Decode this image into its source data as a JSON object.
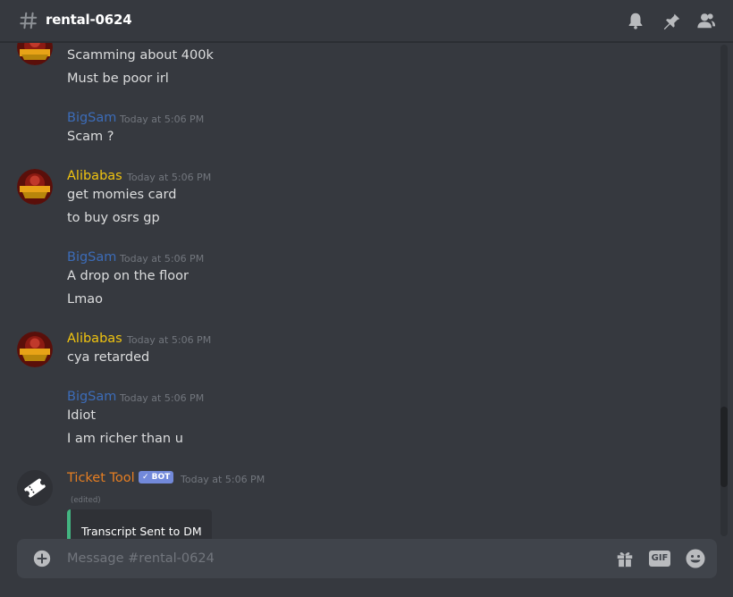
{
  "header": {
    "channel_name": "rental-0624"
  },
  "colors": {
    "big_sam": "#3c6cb8",
    "alibabas": "#f1c40f",
    "ticket_tool": "#e67e22",
    "embed_border": "#43b581"
  },
  "messages": [
    {
      "author": "",
      "timestamp": "",
      "lines": [
        "Scamming about 400k",
        "Must be poor irl"
      ]
    },
    {
      "author": "BigSam",
      "timestamp": "Today at 5:06 PM",
      "lines": [
        "Scam ?"
      ]
    },
    {
      "author": "Alibabas",
      "timestamp": "Today at 5:06 PM",
      "lines": [
        "get momies card",
        "to buy osrs gp"
      ]
    },
    {
      "author": "BigSam",
      "timestamp": "Today at 5:06 PM",
      "lines": [
        "A drop on the floor",
        "Lmao"
      ]
    },
    {
      "author": "Alibabas",
      "timestamp": "Today at 5:06 PM",
      "lines": [
        "cya retarded"
      ]
    },
    {
      "author": "BigSam",
      "timestamp": "Today at 5:06 PM",
      "lines": [
        "Idiot",
        "I am richer than u"
      ]
    },
    {
      "author": "Ticket Tool",
      "badge": "✓ BOT",
      "timestamp": "Today at 5:06 PM",
      "edited": "(edited)",
      "embed_title": "Transcript Sent to DM"
    }
  ],
  "composer": {
    "placeholder": "Message #rental-0624",
    "gif_label": "GIF"
  }
}
